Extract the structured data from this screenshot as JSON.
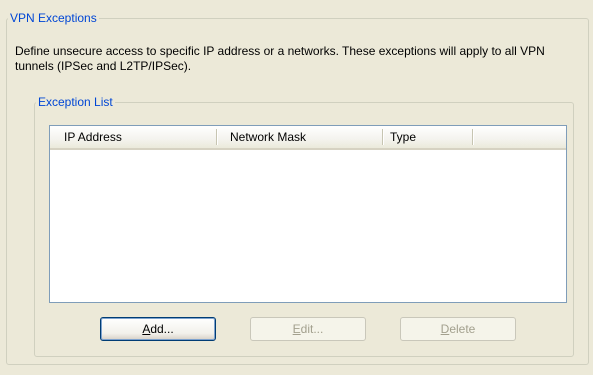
{
  "vpn_exceptions": {
    "title": "VPN Exceptions",
    "description": "Define unsecure access to specific IP address or a networks.  These exceptions will apply to all VPN tunnels (IPSec and L2TP/IPSec).",
    "exception_list": {
      "title": "Exception List",
      "columns": [
        "IP Address",
        "Network Mask",
        "Type"
      ],
      "rows": []
    },
    "buttons": {
      "add": {
        "mnemonic": "A",
        "rest": "dd...",
        "enabled": true
      },
      "edit": {
        "mnemonic": "E",
        "rest": "dit...",
        "enabled": false
      },
      "delete": {
        "mnemonic": "D",
        "rest": "elete",
        "enabled": false
      }
    }
  },
  "colors": {
    "background": "#ECE9D8",
    "groupbox_title": "#0046D5",
    "border": "#D0D0BF",
    "listview_border": "#7F9DB9",
    "disabled_text": "#A3A08E"
  }
}
